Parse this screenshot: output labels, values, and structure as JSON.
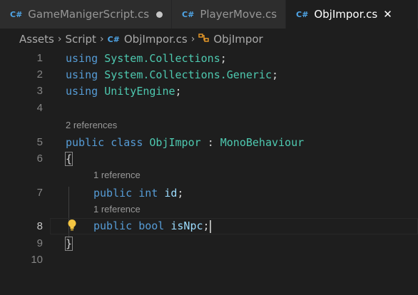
{
  "tabs": [
    {
      "label": "GameManigerScript.cs",
      "icon": "csharp-file-icon",
      "modified": true
    },
    {
      "label": "PlayerMove.cs",
      "icon": "csharp-file-icon"
    },
    {
      "label": "ObjImpor.cs",
      "icon": "csharp-file-icon",
      "active": true,
      "close": "✕"
    }
  ],
  "breadcrumb": {
    "items": [
      "Assets",
      "Script",
      "ObjImpor.cs",
      "ObjImpor"
    ],
    "separator": "›"
  },
  "file_icon_glyph": "C#",
  "editor": {
    "line_numbers": [
      "1",
      "2",
      "3",
      "4",
      "5",
      "6",
      "7",
      "8",
      "9",
      "10"
    ],
    "current_line": "8",
    "lens": {
      "class_refs": "2 references",
      "id_refs": "1 reference",
      "npc_refs": "1 reference"
    },
    "code": {
      "l1_kw": "using",
      "l1_ns": "System.Collections",
      "l2_kw": "using",
      "l2_ns": "System.Collections.Generic",
      "l3_kw": "using",
      "l3_ns": "UnityEngine",
      "semicolon": ";",
      "l5_public": "public",
      "l5_class": "class",
      "l5_name": "ObjImpor",
      "l5_colon": ":",
      "l5_base": "MonoBehaviour",
      "open_brace": "{",
      "l7_public": "public",
      "l7_type": "int",
      "l7_name": "id",
      "l8_public": "public",
      "l8_type": "bool",
      "l8_name": "isNpc",
      "close_brace": "}"
    }
  },
  "colors": {
    "background": "#1e1e1e",
    "keyword": "#569cd6",
    "type": "#4ec9b0",
    "identifier": "#9cdcfe",
    "lightbulb": "#f4c542"
  }
}
